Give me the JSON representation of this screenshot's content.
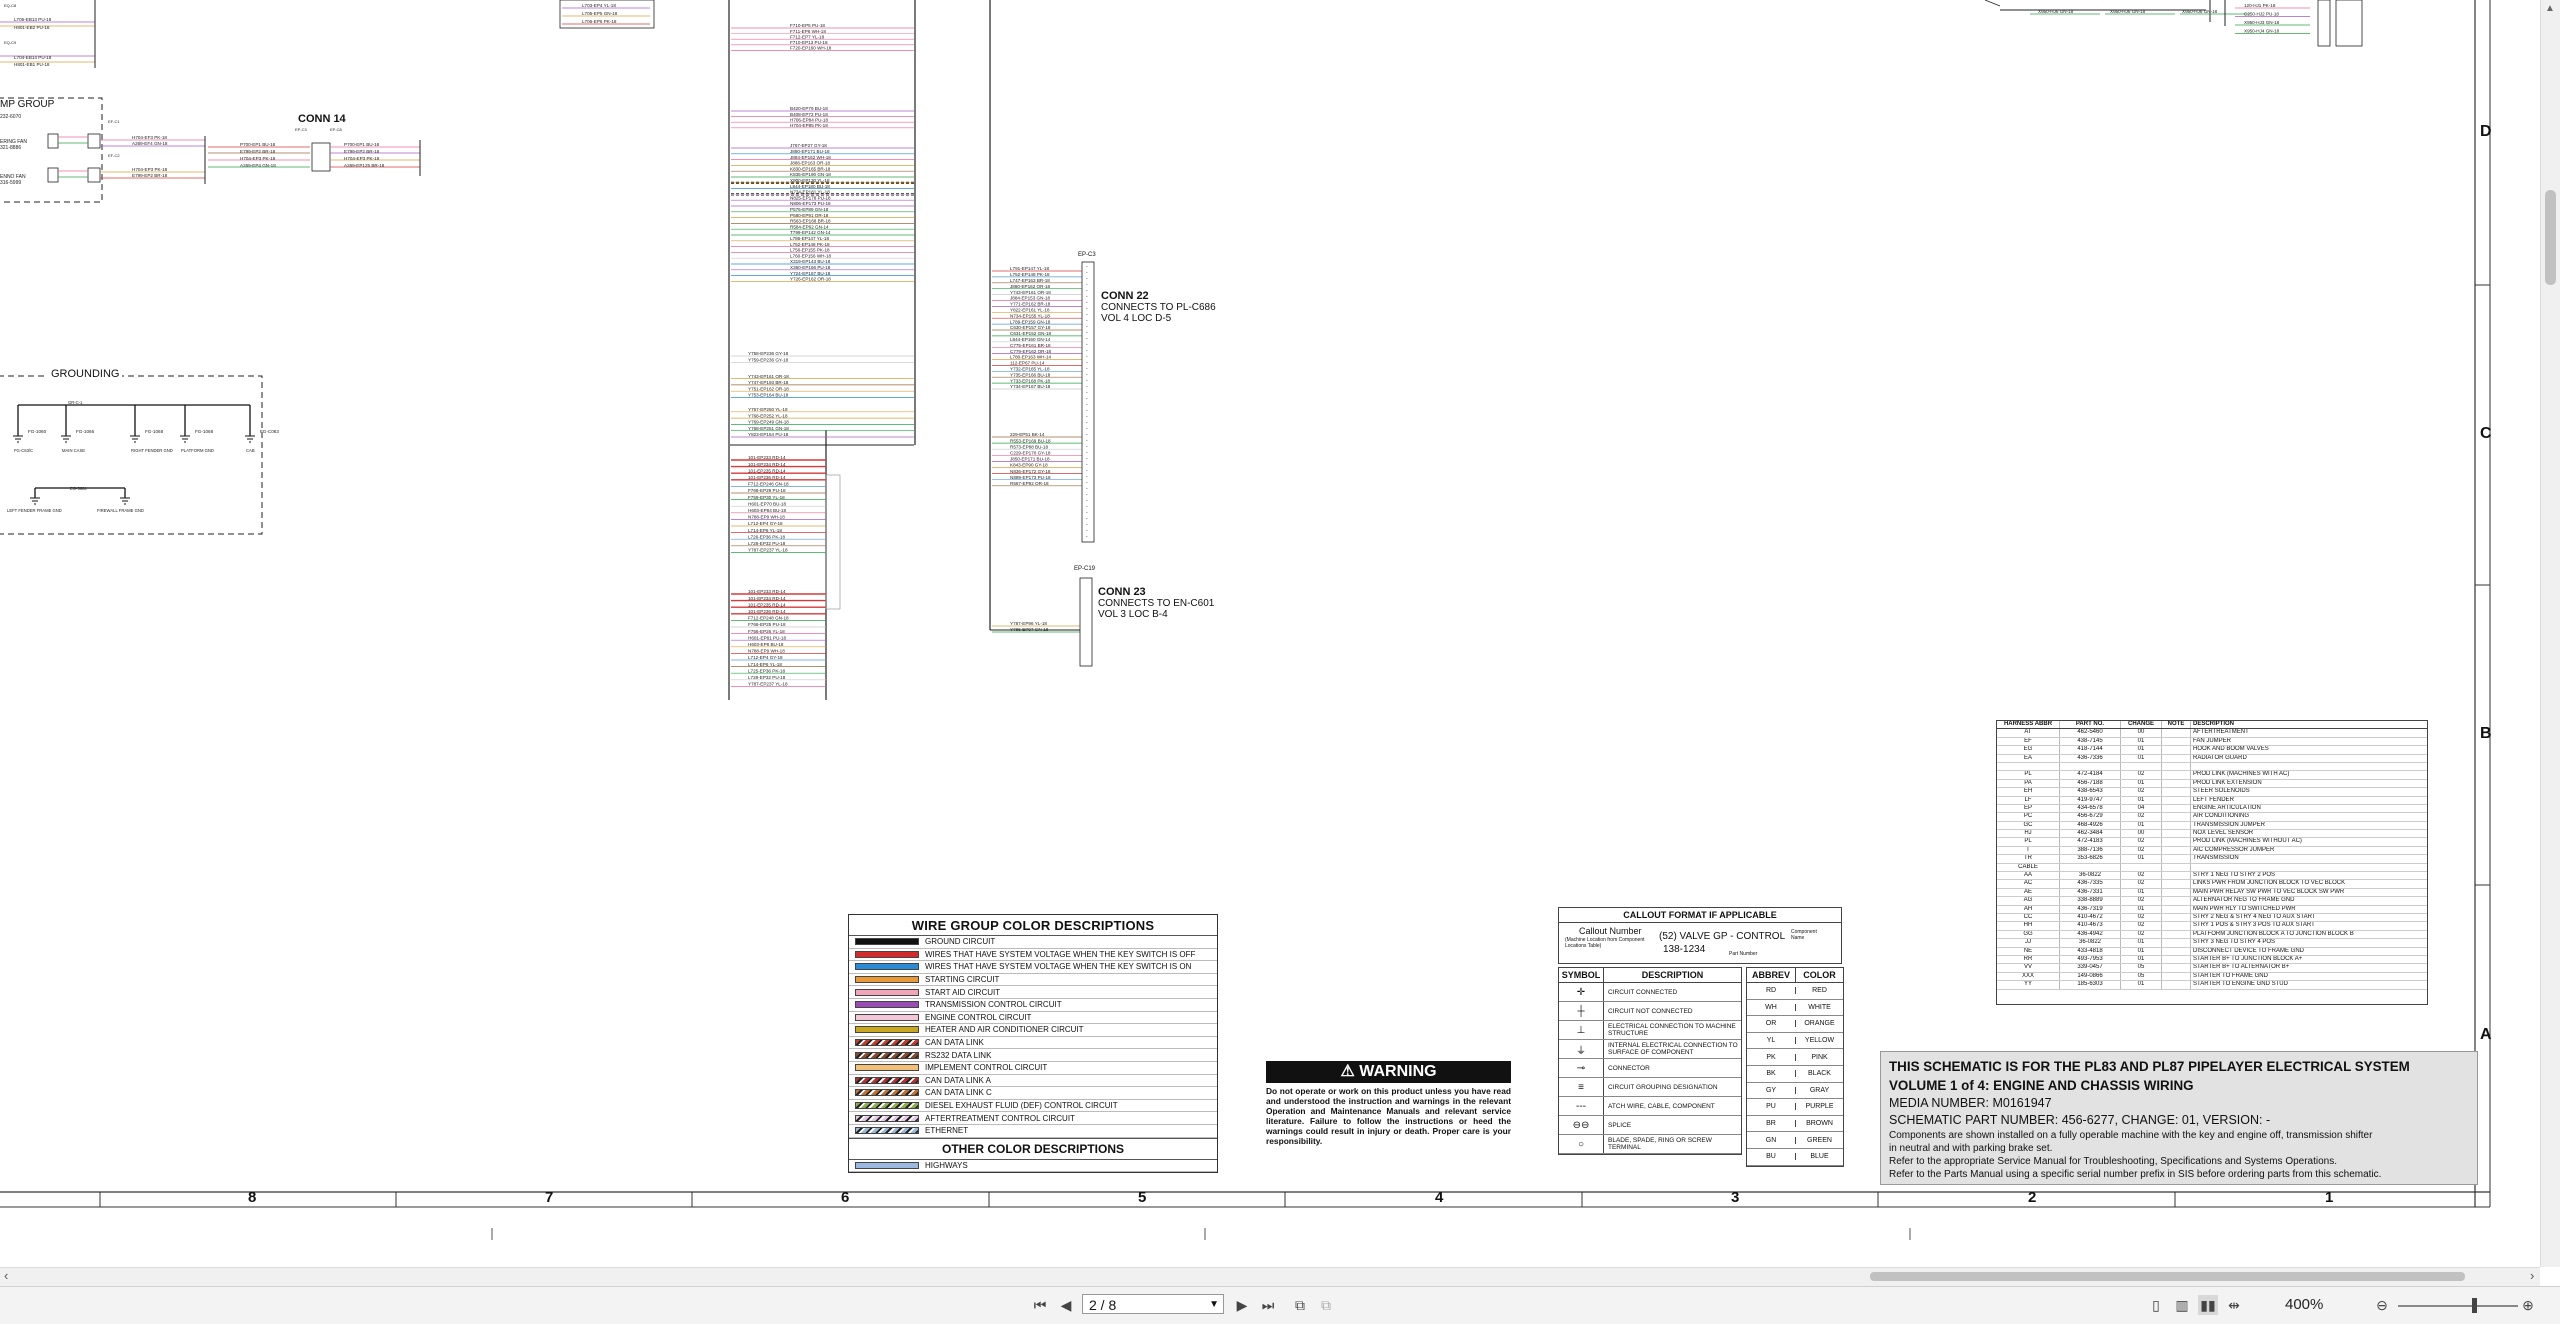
{
  "schematic": {
    "conn14": {
      "title": "CONN 14",
      "pins_left": [
        "H704-EF3 PK-18",
        "A269-EF4 GN-18",
        "H704-EP3 PK-18",
        "E799-EP2 BR-18"
      ],
      "pins_right": [
        "P700-EP1 BU-18",
        "E799-EP2 BR-18",
        "H704-EP3 PK-18",
        "A269-EP125 BR-18"
      ]
    },
    "conn22": {
      "title": "CONN 22",
      "line1": "CONNECTS TO PL-C686",
      "line2": "VOL 4 LOC D-5",
      "part": "EP-C3"
    },
    "conn23": {
      "title": "CONN 23",
      "line1": "CONNECTS TO EN-C601",
      "line2": "VOL 3 LOC B-4",
      "part": "EP-C19"
    },
    "grounding_title": "GROUNDING",
    "group_title": "MP GROUP",
    "wires_upper": [
      "F710-EP5 PU-18",
      "F711-EP6 WH-18",
      "F712-EP7 YL-18",
      "F710-EP13 PU-18",
      "F720-EP160 WH-18",
      "B420-EP79 BU-18",
      "B408-EP72 PU-18",
      "H706-EP84 PU-18",
      "H704-EP85 PK-18"
    ],
    "wires_mid": [
      "J767-EP27 GY-18",
      "J880-EP171 BU-18",
      "J884-EP162 WH-18",
      "J886-EP163 OR-18",
      "K830-EP165 BR-18",
      "K835-EP190 GN-18",
      "X900-EP130 YL-18",
      "L844-EP180 BU-18",
      "N734-EP181 YL-18",
      "N825-EP178 PU-18",
      "N806-EP173 PU-18",
      "P576-EP89 GN-18",
      "P580-EP91 OR-18",
      "R563-EP168 BR-18",
      "R584-EP62 GN-14",
      "T799-EP142 GN-14",
      "L786-EP147 YL-18",
      "L752-EP148 PK-18",
      "L756-EP155 PK-18",
      "L760-EP156 WH-18",
      "X319-EP143 BU-18",
      "X360-EP166 PU-18",
      "Y724-EP167 BU-18",
      "Y726-EP162 OR-18"
    ],
    "wires_low": [
      "Y758-EP236 GY-18",
      "Y759-EP236 GY-18",
      "Y743-EP161 OR-18",
      "Y747-EP193 BR-18",
      "Y751-EP162 OR-18",
      "Y753-EP164 BU-18",
      "Y767-EP250 YL-18",
      "Y768-EP252 YL-18",
      "Y769-EP249 GN-18",
      "Y768-EP251 GN-18",
      "Y823-EP154 PU-18"
    ],
    "wires_red": [
      "101-EP233 RD-14",
      "101-EP234 RD-14",
      "101-EP235 RD-14",
      "101-EP236 RD-14",
      "F712-EP246 GN-18",
      "F768-EP29 PU-18",
      "F759-EP30 YL-18",
      "H601-EP70 BU-18",
      "H603-EP84 BU-18",
      "N788-EP9 WH-18",
      "L712-EP4 GY-18",
      "L714-EP6 YL-18",
      "L726-EP36 PK-18",
      "L728-EP32 PU-18",
      "Y787-EP237 YL-18"
    ],
    "wires_red2": [
      "101-EP233 RD-14",
      "101-EP234 RD-14",
      "101-EP235 RD-14",
      "101-EP236 RD-14",
      "F712-EP248 GN-18",
      "F766-EP25 PU-18",
      "F756-EP26 YL-18",
      "H601-EP81 PU-18",
      "H603-EP8 BU-18",
      "N788-EP9 WH-18",
      "L712-EP4 GY-18",
      "L714-EP6 YL-18",
      "L725-EP36 PK-18",
      "L728-EP32 PU-18",
      "Y787-EP237 YL-18"
    ],
    "wires_conn22": [
      "L791-EP147 YL-18",
      "L752-EP148 PK-18",
      "L747-EP163 BR-18",
      "J880-EP162 OR-18",
      "Y743-EP161 OR-18",
      "J884-EP153 GN-18",
      "Y771-EP162 BR-18",
      "Y822-EP161 YL-18",
      "N734-EP155 YL-18",
      "L789-EP159 GN-18",
      "C630-EP157 GY-18",
      "C631-EP152 GN-18",
      "L844-EP160 GN-14",
      "C775-EP161 BR-18",
      "C779-EP162 OR-18",
      "L780-EP163 WH-14",
      "112-EP67 PU-14",
      "Y732-EP165 YL-18",
      "Y735-EP166 BU-18",
      "Y733-EP168 PK-18",
      "Y734-EP167 BU-18"
    ],
    "wires_conn22b": [
      "229-EP51 BK-14",
      "R553-EP169 BU-18",
      "R573-EP88 BU-18",
      "C229-EP170 GY-18",
      "J850-EP171 BU-18",
      "K843-EP90 GY-18",
      "N836-EP172 GY-18",
      "N889-EP173 PU-18",
      "R567-EP92 OR-18"
    ],
    "wires_conn23": [
      "Y787-EP96 YL-18",
      "Y786-EP97 GN-18"
    ],
    "ground_points": [
      "FG-1060",
      "FG-1066",
      "FG-1068",
      "FG-1068",
      "FG-C063"
    ],
    "ground_labels": [
      "FG-C63/C",
      "MAIN CASE",
      "RIGHT FENDER GND",
      "PLATFORM GND",
      "CAB"
    ],
    "ground_bottom": [
      "LEFT FENDER FRAME GND",
      "FIREWALL FRAME GND"
    ],
    "top_right_wires": [
      "X950-HJ6 GN-18",
      "X950-HJ6 GN-18",
      "X950-HJ6 GN-18",
      "120-HJ1 PK-18",
      "C250-HJ2 PU-18",
      "X950-HJ3 GN-18",
      "X950-HJ4 GN-18"
    ]
  },
  "color_table": {
    "title": "WIRE GROUP COLOR DESCRIPTIONS",
    "rows": [
      {
        "label": "GROUND CIRCUIT",
        "color": "#111111",
        "pattern": "solid"
      },
      {
        "label": "WIRES THAT HAVE SYSTEM VOLTAGE WHEN THE KEY SWITCH IS OFF",
        "color": "#d62a2a",
        "pattern": "solid"
      },
      {
        "label": "WIRES THAT HAVE SYSTEM VOLTAGE WHEN THE KEY SWITCH IS ON",
        "color": "#2b8bd6",
        "pattern": "solid"
      },
      {
        "label": "STARTING CIRCUIT",
        "color": "#e89a3a",
        "pattern": "solid"
      },
      {
        "label": "START AID CIRCUIT",
        "color": "#f0a6b8",
        "pattern": "solid"
      },
      {
        "label": "TRANSMISSION CONTROL CIRCUIT",
        "color": "#9a4bb5",
        "pattern": "solid"
      },
      {
        "label": "ENGINE CONTROL CIRCUIT",
        "color": "#f2c7d8",
        "pattern": "solid"
      },
      {
        "label": "HEATER AND AIR CONDITIONER CIRCUIT",
        "color": "#c8a61e",
        "pattern": "solid"
      },
      {
        "label": "CAN DATA LINK",
        "color": "#c43b2a",
        "pattern": "hatch"
      },
      {
        "label": "RS232 DATA LINK",
        "color": "#8a4a2a",
        "pattern": "hatch"
      },
      {
        "label": "IMPLEMENT CONTROL CIRCUIT",
        "color": "#f3c07a",
        "pattern": "solid"
      },
      {
        "label": "CAN DATA LINK A",
        "color": "#b03030",
        "pattern": "hatch"
      },
      {
        "label": "CAN DATA LINK C",
        "color": "#c07030",
        "pattern": "hatch"
      },
      {
        "label": "DIESEL EXHAUST FLUID (DEF) CONTROL CIRCUIT",
        "color": "#8ab04a",
        "pattern": "hatch"
      },
      {
        "label": "AFTERTREATMENT CONTROL CIRCUIT",
        "color": "#e8c8e8",
        "pattern": "hatch"
      },
      {
        "label": "ETHERNET",
        "color": "#9ab8d8",
        "pattern": "hatch"
      }
    ],
    "other_title": "OTHER COLOR DESCRIPTIONS",
    "other_rows": [
      {
        "label": "HIGHWAYS",
        "color": "#9ab8e0",
        "pattern": "solid"
      }
    ]
  },
  "warning": {
    "title": "WARNING",
    "text": "Do not operate or work on this product unless you have read and understood the instruction and warnings in the relevant Operation and Maintenance Manuals and relevant service literature. Failure to follow the instructions or heed the warnings could result in injury or death. Proper care is your responsibility."
  },
  "callout": {
    "title": "CALLOUT FORMAT IF APPLICABLE",
    "callout_number": "Callout Number",
    "callout_note": "(Machine Location from Component Locations Table)",
    "example": "(52) VALVE GP - CONTROL",
    "part": "138-1234",
    "component_name": "Component Name",
    "part_number_label": "Part Number",
    "symbol_header": "SYMBOL",
    "desc_header": "DESCRIPTION",
    "symbols": [
      {
        "glyph": "✛",
        "desc": "CIRCUIT CONNECTED"
      },
      {
        "glyph": "┼",
        "desc": "CIRCUIT NOT CONNECTED"
      },
      {
        "glyph": "⊥",
        "desc": "ELECTRICAL CONNECTION TO MACHINE STRUCTURE"
      },
      {
        "glyph": "⏚",
        "desc": "INTERNAL ELECTRICAL CONNECTION TO SURFACE OF COMPONENT"
      },
      {
        "glyph": "⊸",
        "desc": "CONNECTOR"
      },
      {
        "glyph": "≡",
        "desc": "CIRCUIT GROUPING DESIGNATION"
      },
      {
        "glyph": "---",
        "desc": "ATCH WIRE, CABLE, COMPONENT"
      },
      {
        "glyph": "⊖⊖",
        "desc": "SPLICE"
      },
      {
        "glyph": "○",
        "desc": "BLADE, SPADE, RING OR SCREW TERMINAL"
      }
    ],
    "abbrev_header": "ABBREV",
    "color_header": "COLOR",
    "abbrevs": [
      {
        "a": "RD",
        "c": "RED"
      },
      {
        "a": "WH",
        "c": "WHITE"
      },
      {
        "a": "OR",
        "c": "ORANGE"
      },
      {
        "a": "YL",
        "c": "YELLOW"
      },
      {
        "a": "PK",
        "c": "PINK"
      },
      {
        "a": "BK",
        "c": "BLACK"
      },
      {
        "a": "GY",
        "c": "GRAY"
      },
      {
        "a": "PU",
        "c": "PURPLE"
      },
      {
        "a": "BR",
        "c": "BROWN"
      },
      {
        "a": "GN",
        "c": "GREEN"
      },
      {
        "a": "BU",
        "c": "BLUE"
      }
    ]
  },
  "title_block": {
    "line1": "THIS SCHEMATIC IS FOR THE PL83 AND PL87 PIPELAYER ELECTRICAL SYSTEM",
    "line2": "VOLUME 1 of 4: ENGINE AND CHASSIS WIRING",
    "line3": "MEDIA NUMBER: M0161947",
    "line4": "SCHEMATIC PART NUMBER: 456-6277, CHANGE: 01, VERSION: -",
    "line5": "Components are shown installed on a fully operable machine with the key and engine off, transmission shifter",
    "line6": "in neutral and with parking brake set.",
    "line7": "Refer to the appropriate Service Manual for Troubleshooting, Specifications and Systems Operations.",
    "line8": "Refer to the Parts Manual using a specific serial number prefix in SIS before ordering parts from this schematic."
  },
  "harness_table": {
    "headers": [
      "HARNESS ABBR",
      "PART NO.",
      "CHANGE",
      "NOTE",
      "DESCRIPTION"
    ],
    "rows": [
      [
        "AT",
        "462-5460",
        "00",
        "",
        "AFTERTREATMENT"
      ],
      [
        "EF",
        "438-7145",
        "01",
        "",
        "FAN JUMPER"
      ],
      [
        "EG",
        "418-7144",
        "01",
        "",
        "HOOK AND BOOM VALVES"
      ],
      [
        "EA",
        "436-7336",
        "01",
        "",
        "RADIATOR GUARD"
      ],
      [
        "",
        "",
        "",
        "",
        ""
      ],
      [
        "PL",
        "472-4184",
        "02",
        "",
        "PROD LINK (MACHINES WITH AC)"
      ],
      [
        "PA",
        "456-7188",
        "01",
        "",
        "PROD LINK EXTENSION"
      ],
      [
        "EH",
        "438-6543",
        "02",
        "",
        "STEER SOLENOIDS"
      ],
      [
        "LF",
        "419-9747",
        "01",
        "",
        "LEFT FENDER"
      ],
      [
        "EP",
        "434-6578",
        "04",
        "",
        "ENGINE ARTICULATION"
      ],
      [
        "PC",
        "456-6729",
        "02",
        "",
        "AIR CONDITIONING"
      ],
      [
        "GC",
        "468-4926",
        "01",
        "",
        "TRANSMISSION JUMPER"
      ],
      [
        "HJ",
        "462-3484",
        "00",
        "",
        "NOX LEVEL SENSOR"
      ],
      [
        "PL",
        "472-4183",
        "02",
        "",
        "PROD LINK (MACHINES WITHOUT AC)"
      ],
      [
        "T",
        "388-7136",
        "02",
        "",
        "AIC COMPRESSOR JUMPER"
      ],
      [
        "TR",
        "353-6826",
        "01",
        "",
        "TRANSMISSION"
      ],
      [
        "CABLE",
        "",
        "",
        "",
        ""
      ],
      [
        "AA",
        "36-0822",
        "02",
        "",
        "STRY 1 NEG TO STRY 2 POS"
      ],
      [
        "AC",
        "436-7335",
        "02",
        "",
        "LINKS PWR FROM JUNCTION BLOCK TO VEC BLOCK"
      ],
      [
        "AE",
        "436-7331",
        "01",
        "",
        "MAIN PWR RELAY SW PWR TO VEC BLOCK SW PWR"
      ],
      [
        "AG",
        "338-8889",
        "02",
        "",
        "ALTERNATOR NEG TO FRAME GND"
      ],
      [
        "AH",
        "436-7319",
        "01",
        "",
        "MAIN PWR RLY TO SWITCHED PWR"
      ],
      [
        "CC",
        "410-4672",
        "02",
        "",
        "STRY 2 NEG & STRY 4 NEG TO AUX START"
      ],
      [
        "HH",
        "410-4673",
        "02",
        "",
        "STRY 1 POS & STRY 3 POS TO AUX START"
      ],
      [
        "GG",
        "436-4942",
        "02",
        "",
        "PLATFORM JUNCTION BLOCK A TO JUNCTION BLOCK B"
      ],
      [
        "JJ",
        "36-0822",
        "01",
        "",
        "STRY 3 NEG TO STRY 4 POS"
      ],
      [
        "NE",
        "433-4818",
        "01",
        "",
        "DISCONNECT DEVICE TO FRAME GND"
      ],
      [
        "RR",
        "493-7953",
        "01",
        "",
        "STARTER B+ TO JUNCTION BLOCK A+"
      ],
      [
        "VV",
        "339-0457",
        "05",
        "",
        "STARTER B+ TO ALTERNATOR B+"
      ],
      [
        "XXX",
        "149-0866",
        "05",
        "",
        "STARTER TO FRAME GND"
      ],
      [
        "YY",
        "185-6303",
        "01",
        "",
        "STARTER TO ENGINE GND STUD"
      ]
    ]
  },
  "grid": {
    "cols": [
      "8",
      "7",
      "6",
      "5",
      "4",
      "3",
      "2",
      "1"
    ],
    "rows": [
      "D",
      "C",
      "B",
      "A"
    ]
  },
  "viewer": {
    "page_value": "2 / 8",
    "zoom": "400%"
  }
}
